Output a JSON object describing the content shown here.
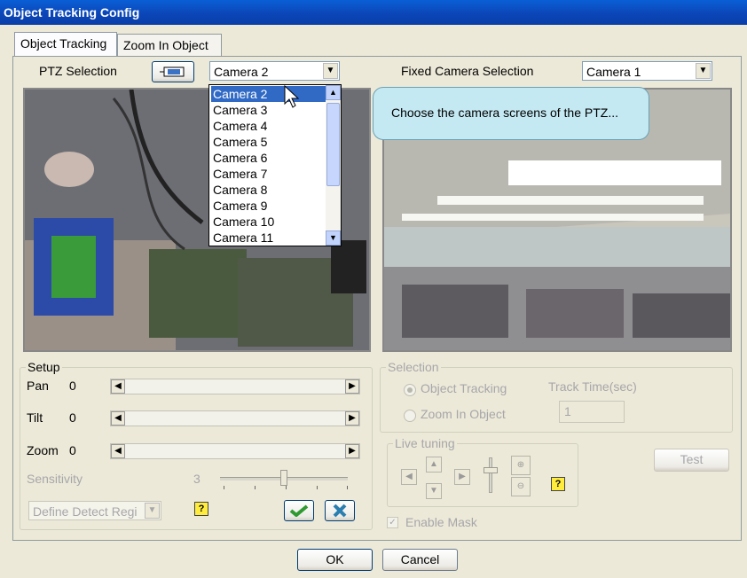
{
  "window": {
    "title": "Object Tracking Config"
  },
  "tabs": [
    {
      "label": "Object Tracking"
    },
    {
      "label": "Zoom In Object"
    }
  ],
  "ptz": {
    "label": "PTZ Selection",
    "selected": "Camera 2",
    "options": [
      "Camera 2",
      "Camera 3",
      "Camera 4",
      "Camera 5",
      "Camera 6",
      "Camera 7",
      "Camera 8",
      "Camera 9",
      "Camera 10",
      "Camera 11"
    ]
  },
  "fixed": {
    "label": "Fixed Camera Selection",
    "selected": "Camera 1"
  },
  "tooltip": {
    "text": "Choose the camera screens of the PTZ..."
  },
  "setup": {
    "legend": "Setup",
    "pan": {
      "label": "Pan",
      "value": "0"
    },
    "tilt": {
      "label": "Tilt",
      "value": "0"
    },
    "zoom": {
      "label": "Zoom",
      "value": "0"
    },
    "sensitivity": {
      "label": "Sensitivity",
      "value": "3",
      "level": 0.5
    },
    "define_region": "Define Detect Regi"
  },
  "selection": {
    "legend": "Selection",
    "object_tracking": "Object Tracking",
    "zoom_in_object": "Zoom In Object",
    "track_time_label": "Track Time(sec)",
    "track_time_value": "1"
  },
  "live_tuning": {
    "legend": "Live tuning"
  },
  "test_label": "Test",
  "enable_mask": "Enable Mask",
  "ok_label": "OK",
  "cancel_label": "Cancel",
  "colors": {
    "title_bar": "#0b46b8",
    "selection": "#316ac5",
    "tooltip": "#c5e9f3"
  }
}
